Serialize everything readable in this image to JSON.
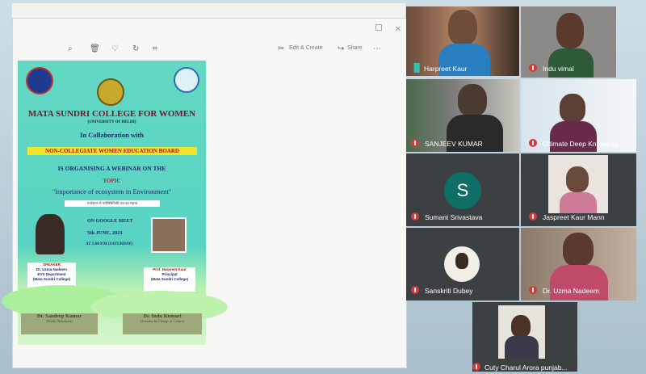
{
  "toolbar": {
    "edit_create_label": "Edit & Create",
    "share_label": "Share"
  },
  "poster": {
    "college": "MATA SUNDRI COLLEGE FOR WOMEN",
    "university": "(UNIVERSITY OF DELHI)",
    "collab": "In Collaboration with",
    "board": "NON-COLLEGIATE WOMEN EDUCATION BOARD",
    "organising": "IS ORGANISING A WEBINAR ON THE",
    "topic_label": "TOPIC",
    "topic": "\"Importance of ecosystem in Environment\"",
    "hindi": "पर्यावरण में पारिस्थितिकी तंत्र का महत्त्व",
    "platform": "ON GOOGLE MEET",
    "date": "5th JUNE, 2021",
    "time": "AT 5:00 P.M (SATURDAY)",
    "speaker_card": [
      "SPEAKER",
      "Dr. Uzma Nadeem",
      "EVS Department",
      "(Mata Sundri College)"
    ],
    "principal_card": [
      "Prof. Harpreet Kaur",
      "Principal",
      "(Mata Sundri College)"
    ],
    "left_bar": [
      "Dr. Sandeep Kumar",
      "(Public Relations)"
    ],
    "right_bar": [
      "Dr. Indu Kumari",
      "(Teacher In-Charge of Centre)"
    ]
  },
  "participants": [
    {
      "name": "Harpreet Kaur",
      "muted": false
    },
    {
      "name": "Indu vimal",
      "muted": true
    },
    {
      "name": "SANJEEV KUMAR",
      "muted": true
    },
    {
      "name": "Ultimate Deep Knowledg...",
      "muted": true
    },
    {
      "name": "Sumant Srivastava",
      "muted": true,
      "initial": "S"
    },
    {
      "name": "Jaspreet Kaur Mann",
      "muted": true
    },
    {
      "name": "Sanskriti Dubey",
      "muted": true
    },
    {
      "name": "Dr. Uzma Nadeem",
      "muted": true
    },
    {
      "name": "Cuty Charul Arora punjab...",
      "muted": true
    }
  ],
  "colors": {
    "poster_bg": "#5fd6c3",
    "tile_bg": "#3c4043",
    "mute_red": "#d23a3a",
    "avatar_teal": "#0e6f67"
  }
}
